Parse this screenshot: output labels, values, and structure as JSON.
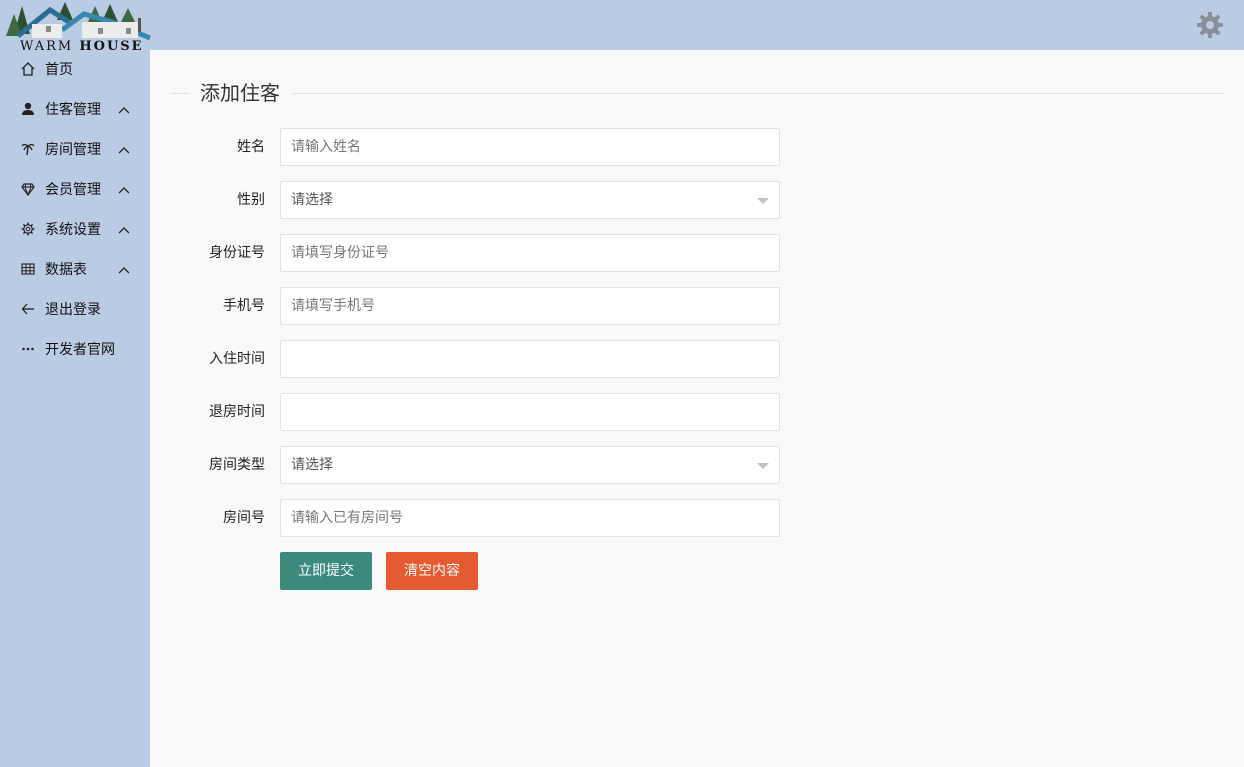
{
  "app": {
    "logo_text_left": "WARM ",
    "logo_text_right": "HOUSE"
  },
  "header": {
    "settings_icon": "gear-icon"
  },
  "sidebar": {
    "items": [
      {
        "label": "首页",
        "icon": "home-icon",
        "expandable": false
      },
      {
        "label": "住客管理",
        "icon": "user-icon",
        "expandable": true
      },
      {
        "label": "房间管理",
        "icon": "palm-tree-icon",
        "expandable": true
      },
      {
        "label": "会员管理",
        "icon": "diamond-icon",
        "expandable": true
      },
      {
        "label": "系统设置",
        "icon": "settings-icon",
        "expandable": true
      },
      {
        "label": "数据表",
        "icon": "table-icon",
        "expandable": true
      },
      {
        "label": "退出登录",
        "icon": "arrow-left-icon",
        "expandable": false
      },
      {
        "label": "开发者官网",
        "icon": "more-icon",
        "expandable": false
      }
    ]
  },
  "form": {
    "title": "添加住客",
    "fields": {
      "name": {
        "label": "姓名",
        "placeholder": "请输入姓名",
        "value": ""
      },
      "gender": {
        "label": "性别",
        "selected": "请选择"
      },
      "id_number": {
        "label": "身份证号",
        "placeholder": "请填写身份证号",
        "value": ""
      },
      "phone": {
        "label": "手机号",
        "placeholder": "请填写手机号",
        "value": ""
      },
      "checkin_time": {
        "label": "入住时间",
        "placeholder": "",
        "value": ""
      },
      "checkout_time": {
        "label": "退房时间",
        "placeholder": "",
        "value": ""
      },
      "room_type": {
        "label": "房间类型",
        "selected": "请选择"
      },
      "room_number": {
        "label": "房间号",
        "placeholder": "请输入已有房间号",
        "value": ""
      }
    },
    "submit_label": "立即提交",
    "reset_label": "清空内容"
  },
  "colors": {
    "sidebar_bg": "#bacbe4",
    "submit_button": "#3b8a7c",
    "reset_button": "#e65a31"
  }
}
